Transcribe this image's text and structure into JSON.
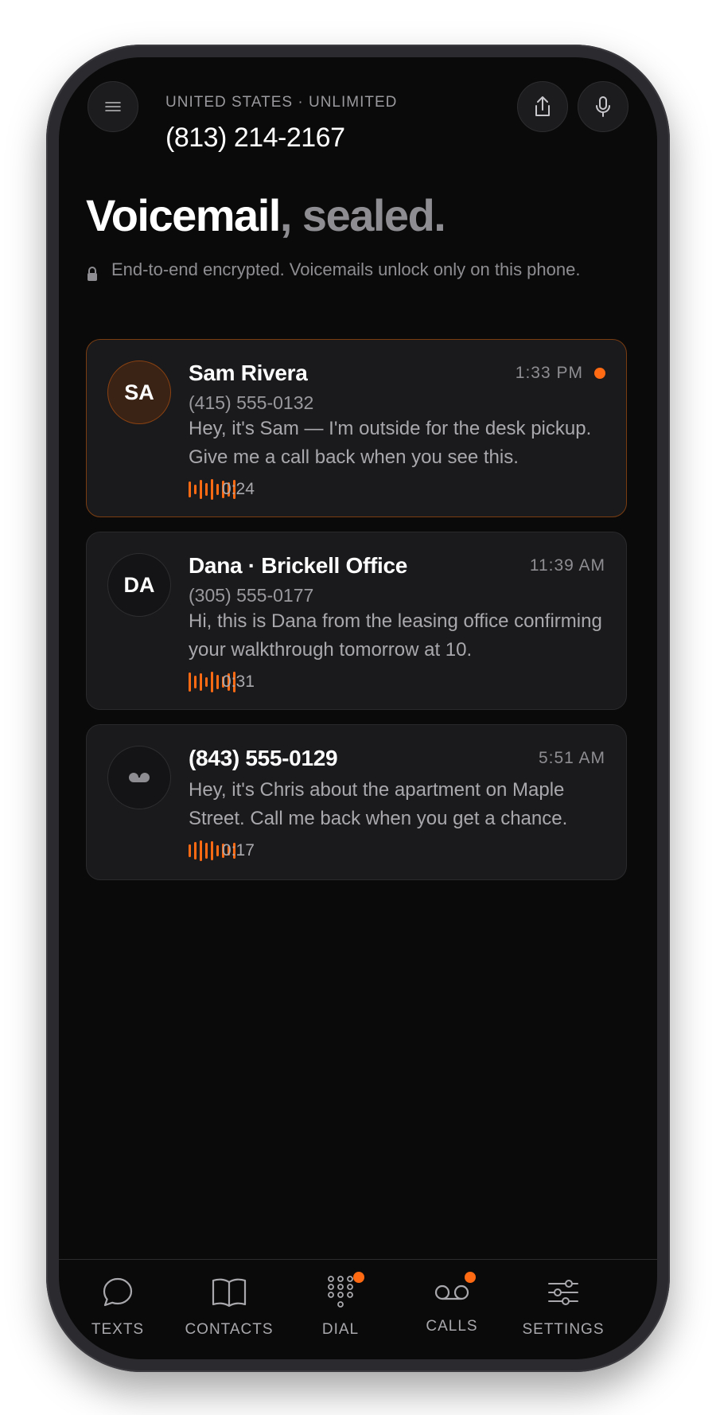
{
  "header": {
    "plan_label": "UNITED STATES · UNLIMITED",
    "phone_number": "(813) 214-2167",
    "menu_icon": "menu-icon",
    "share_icon": "share-icon",
    "mic_icon": "mic-icon"
  },
  "page": {
    "title_main": "Voicemail",
    "title_accent": ", sealed.",
    "encryption_note": "End-to-end encrypted. Voicemails unlock only on this phone."
  },
  "voicemails": [
    {
      "initials": "SA",
      "name": "Sam Rivera",
      "number": "(415) 555-0132",
      "time": "1:33 PM",
      "unread": true,
      "transcript": "Hey, it's Sam — I'm outside for the desk pickup. Give me a call back when you see this.",
      "duration": "0:24"
    },
    {
      "initials": "DA",
      "name": "Dana · Brickell Office",
      "number": "(305) 555-0177",
      "time": "11:39 AM",
      "unread": false,
      "transcript": "Hi, this is Dana from the leasing office confirming your walkthrough tomorrow at 10.",
      "duration": "0:31"
    },
    {
      "initials": "",
      "name": "(843) 555-0129",
      "number": "",
      "time": "5:51 AM",
      "unread": false,
      "transcript": "Hey, it's Chris about the apartment on Maple Street. Call me back when you get a chance.",
      "duration": "0:17"
    }
  ],
  "nav": [
    {
      "label": "TEXTS",
      "icon": "chat-bubble-icon",
      "badge": false
    },
    {
      "label": "CONTACTS",
      "icon": "book-icon",
      "badge": false
    },
    {
      "label": "DIAL",
      "icon": "dialpad-icon",
      "badge": true
    },
    {
      "label": "CALLS",
      "icon": "voicemail-icon",
      "badge": true
    },
    {
      "label": "SETTINGS",
      "icon": "sliders-icon",
      "badge": false
    }
  ],
  "colors": {
    "accent": "#ff6a13",
    "background": "#0a0a0a",
    "card": "#1a1a1c"
  }
}
